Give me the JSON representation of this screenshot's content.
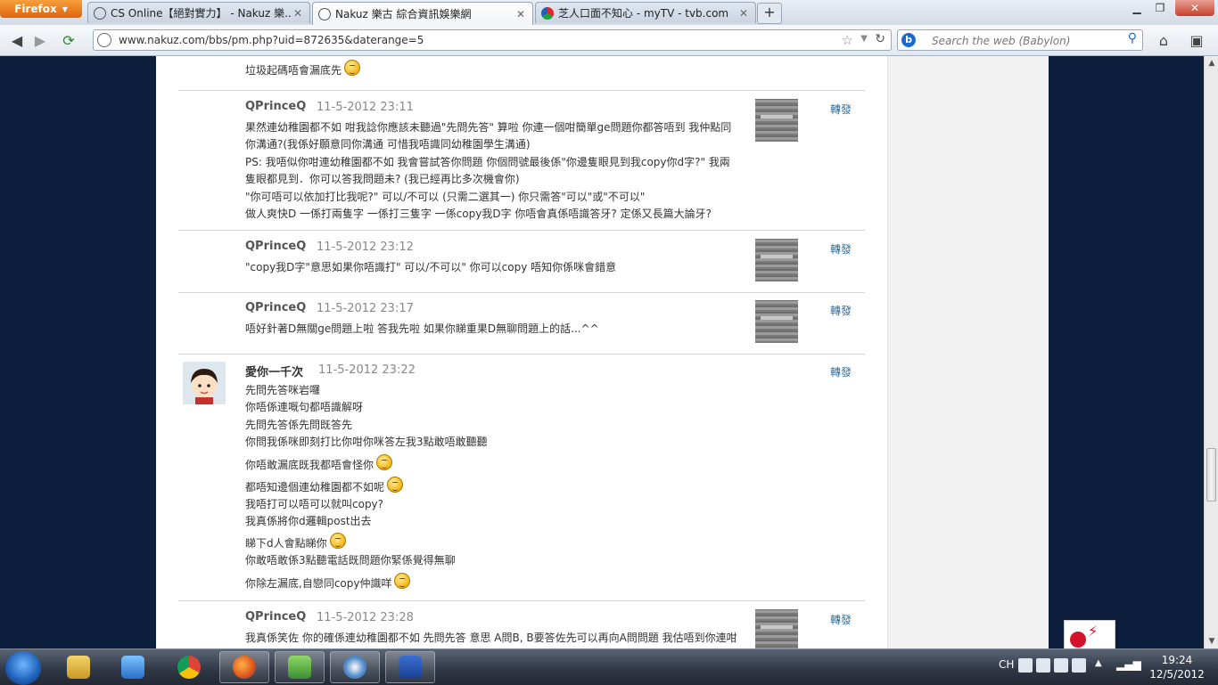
{
  "browser": {
    "app_button": "Firefox",
    "tabs": [
      {
        "label": "CS Online【絕對實力】 - Nakuz 樂...",
        "active": false
      },
      {
        "label": "Nakuz 樂古 綜合資訊娛樂網",
        "active": true
      },
      {
        "label": "芝人口面不知心 - myTV - tvb.com",
        "active": false
      }
    ],
    "new_tab": "+",
    "url": "www.nakuz.com/bbs/pm.php?uid=872635&daterange=5",
    "search_placeholder": "Search the web (Babylon)"
  },
  "thread": {
    "top_fragment": "垃圾起碼唔會漏底先",
    "forward_label": "轉發",
    "posts": [
      {
        "author": "QPrinceQ",
        "time": "11-5-2012 23:11",
        "lines": [
          {
            "text": "果然連幼稚園都不如 咁我諗你應該未聽過\"先問先答\" 算啦 你連一個咁簡單ge問題你都答唔到 我仲點同",
            "emoticon": false
          },
          {
            "text": "你溝通?(我係好願意同你溝通 可惜我唔識同幼稚園學生溝通)",
            "emoticon": false
          },
          {
            "text": "PS: 我唔似你咁連幼稚園都不如 我會嘗試答你問題 你個問號最後係\"你邊隻眼見到我copy你d字?\" 我兩",
            "emoticon": false
          },
          {
            "text": "隻眼都見到．你可以答我問題未? (我已經再比多次機會你)",
            "emoticon": false
          },
          {
            "text": "\"你可唔可以依加打比我呢?\" 可以/不可以 (只需二選其一) 你只需答\"可以\"或\"不可以\"",
            "emoticon": false
          },
          {
            "text": "做人爽快D 一係打兩隻字 一係打三隻字 一係copy我D字 你唔會真係唔識答牙? 定係又長篇大論牙?",
            "emoticon": false
          }
        ]
      },
      {
        "author": "QPrinceQ",
        "time": "11-5-2012 23:12",
        "lines": [
          {
            "text": "\"copy我D字\"意思如果你唔識打\" 可以/不可以\" 你可以copy 唔知你係咪會錯意",
            "emoticon": false
          }
        ]
      },
      {
        "author": "QPrinceQ",
        "time": "11-5-2012 23:17",
        "lines": [
          {
            "text": "唔好針著D無關ge問題上啦 答我先啦 如果你睇重果D無聊問題上的話...^^",
            "emoticon": false
          }
        ]
      },
      {
        "author": "愛你一千次",
        "time": "11-5-2012 23:22",
        "lines": [
          {
            "text": "先問先答咪岩囉",
            "emoticon": false
          },
          {
            "text": "你唔係連嘅句都唔識解呀",
            "emoticon": false
          },
          {
            "text": "先問先答係先問既答先",
            "emoticon": false
          },
          {
            "text": "你問我係咪即刻打比你咁你咪答左我3點敢唔敢聽聽",
            "emoticon": false
          },
          {
            "text": "你唔敢漏底既我都唔會怪你",
            "emoticon": true
          },
          {
            "text": "都唔知邊個連幼稚園都不如呢",
            "emoticon": true
          },
          {
            "text": "我唔打可以唔可以就叫copy?",
            "emoticon": false
          },
          {
            "text": "我真係將你d邏輯post出去",
            "emoticon": false
          },
          {
            "text": "睇下d人會點睇你",
            "emoticon": true
          },
          {
            "text": "你敢唔敢係3點聽電話既問題你緊係覺得無聊",
            "emoticon": false
          },
          {
            "text": "你除左漏底,自戀同copy仲識咩",
            "emoticon": true
          }
        ]
      },
      {
        "author": "QPrinceQ",
        "time": "11-5-2012 23:28",
        "lines": [
          {
            "text": "我真係笑佐 你的確係連幼稚園都不如 先問先答 意思 A問B, B要答佐先可以再向A問問題 我估唔到你連咁",
            "emoticon": false
          }
        ]
      }
    ]
  },
  "taskbar": {
    "language": "CH",
    "time": "19:24",
    "date": "12/5/2012"
  }
}
